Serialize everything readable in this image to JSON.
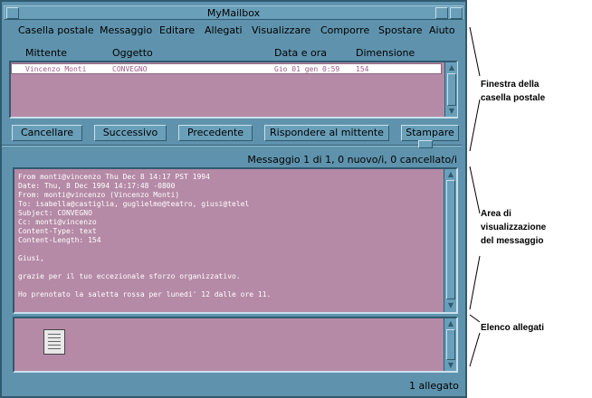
{
  "window": {
    "title": "MyMailbox"
  },
  "menubar": [
    "Casella postale",
    "Messaggio",
    "Editare",
    "Allegati",
    "Visualizzare",
    "Comporre",
    "Spostare",
    "Aiuto"
  ],
  "mailbox": {
    "columns": [
      "Mittente",
      "Oggetto",
      "Data e ora",
      "Dimensione"
    ],
    "rows": [
      {
        "sender": "Vincenzo Monti",
        "subject": "CONVEGNO",
        "date": "Gio 01 gen  0:59",
        "size": "154"
      }
    ]
  },
  "buttons": {
    "delete": "Cancellare",
    "next": "Successivo",
    "previous": "Precedente",
    "reply": "Rispondere al mittente",
    "print": "Stampare"
  },
  "message": {
    "status": "Messaggio 1 di 1, 0 nuovo/i, 0 cancellato/i",
    "lines": [
      "From monti@vincenzo Thu Dec 8 14:17 PST 1994",
      "Date: Thu, 8 Dec 1994 14:17:48 -0800",
      "From: monti@vincenzo (Vincenzo Monti)",
      "To: isabella@castiglia, guglielmo@teatro, giusi@telel",
      "Subject: CONVEGNO",
      "Cc: monti@vincenzo",
      "Content-Type: text",
      "Content-Length: 154",
      "",
      "Giusi,",
      "",
      "grazie per il tuo eccezionale sforzo organizzativo.",
      "",
      "Ho prenotato la saletta rossa per lunedi' 12 dalle ore 11."
    ]
  },
  "attachments": {
    "count_label": "1 allegato",
    "items": [
      {
        "icon": "document-icon"
      }
    ]
  },
  "annotations": {
    "mailbox_window": "Finestra della\ncasella postale",
    "message_area": "Area di\nvisualizzazione\ndel messaggio",
    "attachment_list": "Elenco allegati"
  },
  "colors": {
    "frame": "#5f93ad",
    "pane": "#b58aa6",
    "dark_edge": "#2f5a70"
  }
}
